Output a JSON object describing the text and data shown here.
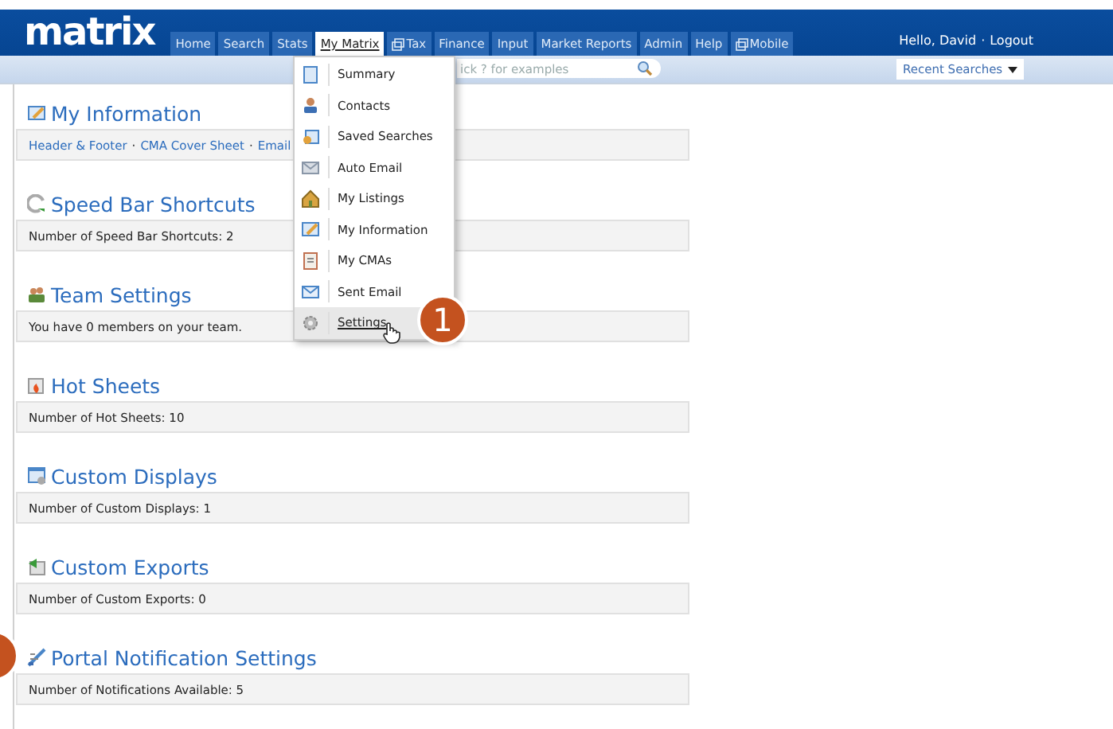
{
  "header": {
    "logo": "matrix",
    "greeting": "Hello, David",
    "separator": "·",
    "logout": "Logout"
  },
  "nav": {
    "tabs": [
      {
        "label": "Home",
        "selected": false,
        "kind": "text"
      },
      {
        "label": "Search",
        "selected": false,
        "kind": "text"
      },
      {
        "label": "Stats",
        "selected": false,
        "kind": "text"
      },
      {
        "label": "My Matrix",
        "selected": true,
        "kind": "text"
      },
      {
        "label": "Tax",
        "selected": false,
        "kind": "with-icon"
      },
      {
        "label": "Finance",
        "selected": false,
        "kind": "text"
      },
      {
        "label": "Input",
        "selected": false,
        "kind": "text"
      },
      {
        "label": "Market Reports",
        "selected": false,
        "kind": "text"
      },
      {
        "label": "Admin",
        "selected": false,
        "kind": "text"
      },
      {
        "label": "Help",
        "selected": false,
        "kind": "text"
      },
      {
        "label": "Mobile",
        "selected": false,
        "kind": "with-icon"
      }
    ]
  },
  "search": {
    "placeholder": "ick ? for examples"
  },
  "recent_searches": {
    "label": "Recent Searches"
  },
  "menu": {
    "items": [
      {
        "label": "Summary",
        "selected": false
      },
      {
        "label": "Contacts",
        "selected": false
      },
      {
        "label": "Saved Searches",
        "selected": false
      },
      {
        "label": "Auto Email",
        "selected": false
      },
      {
        "label": "My Listings",
        "selected": false
      },
      {
        "label": "My Information",
        "selected": false
      },
      {
        "label": "My CMAs",
        "selected": false
      },
      {
        "label": "Sent Email",
        "selected": false
      },
      {
        "label": "Settings",
        "selected": true
      }
    ]
  },
  "sections": [
    {
      "title": "My Information",
      "kind": "links",
      "links": [
        "Header & Footer",
        "CMA Cover Sheet",
        "Email"
      ],
      "separator": "·"
    },
    {
      "title": "Speed Bar Shortcuts",
      "kind": "text",
      "text": "Number of Speed Bar Shortcuts: 2"
    },
    {
      "title": "Team Settings",
      "kind": "text",
      "text": "You have 0 members on your team."
    },
    {
      "title": "Hot Sheets",
      "kind": "text",
      "text": "Number of Hot Sheets: 10"
    },
    {
      "title": "Custom Displays",
      "kind": "text",
      "text": "Number of Custom Displays: 1"
    },
    {
      "title": "Custom Exports",
      "kind": "text",
      "text": "Number of Custom Exports: 0"
    },
    {
      "title": "Portal Notification Settings",
      "kind": "text",
      "text": "Number of Notifications Available: 5"
    }
  ],
  "callouts": [
    {
      "kind": "numbered",
      "label": "1"
    },
    {
      "kind": "cut"
    }
  ]
}
